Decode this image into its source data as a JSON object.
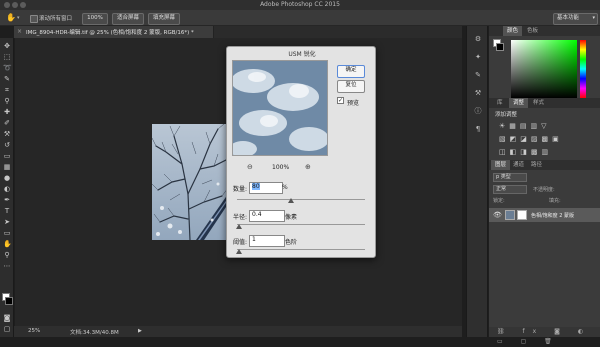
{
  "app": {
    "title": "Adobe Photoshop CC 2015"
  },
  "options_bar": {
    "scroll_all_windows_label": "滚动所有窗口",
    "zoom_100_label": "100%",
    "fit_screen_label": "适合屏幕",
    "fill_screen_label": "填充屏幕",
    "workspace_label": "基本功能"
  },
  "document_tab": {
    "close_glyph": "×",
    "label": "IMG_8904-HDR-编辑.tif @ 25% (色相/饱和度 2 蒙版, RGB/16*) *"
  },
  "dialog": {
    "title": "USM 锐化",
    "ok_label": "确定",
    "reset_label": "复位",
    "preview_label": "预览",
    "preview_checked": true,
    "zoom_level": "100%",
    "amount_label": "数量:",
    "amount_value": "80",
    "amount_unit": "%",
    "radius_label": "半径:",
    "radius_value": "0.4",
    "radius_unit": "像素",
    "threshold_label": "阈值:",
    "threshold_value": "1",
    "threshold_unit": "色阶"
  },
  "status_bar": {
    "zoom": "25%",
    "doc_info": "文档:34.3M/40.8M"
  },
  "right_panel": {
    "color_tabs": [
      "颜色",
      "色板"
    ],
    "library_tabs": [
      "库",
      "调整",
      "样式"
    ],
    "adjustments_title": "添加调整",
    "layers_tabs": [
      "图层",
      "通道",
      "路径"
    ],
    "layer_kind_label": "p 类型",
    "blend_mode": "正常",
    "opacity_label": "不透明度:",
    "lock_label": "锁定:",
    "fill_label": "填充:",
    "layer_name": "色相/饱和度 2 蒙版"
  },
  "colors": {
    "foreground": "#ffffff",
    "background": "#000000",
    "accent": "#5a8ad8"
  }
}
